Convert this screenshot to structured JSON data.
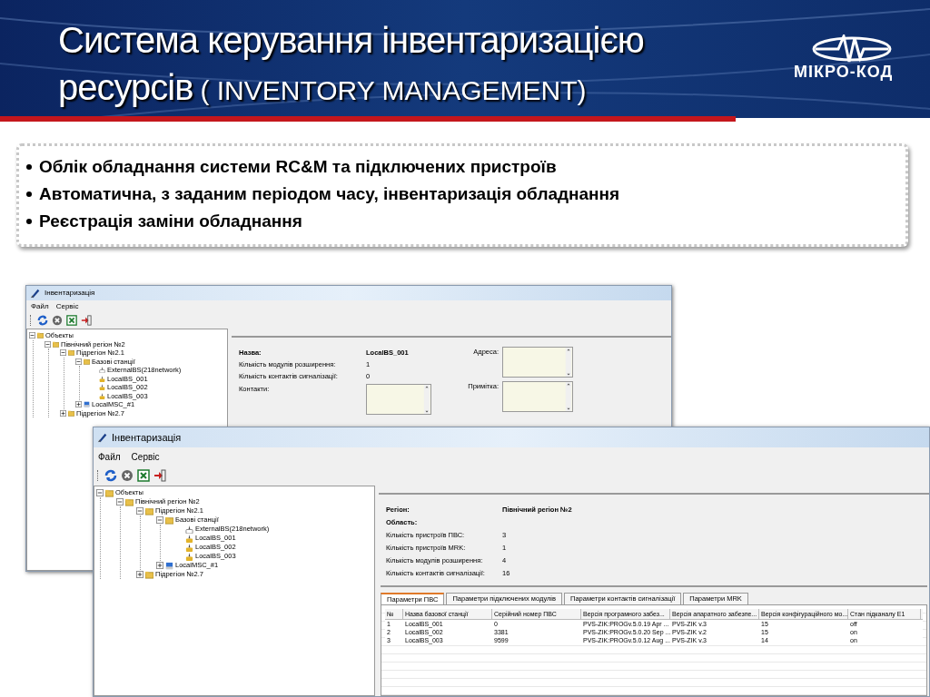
{
  "slide": {
    "title_line1": "Система керування інвентаризацією",
    "title_line2": "ресурсів",
    "title_suffix": "( INVENTORY MANAGEMENT)",
    "logo_text": "МІКРО-КОД",
    "bullets": [
      "Облік обладнання системи RC&M та підключених пристроїв",
      "Автоматична, з заданим періодом часу, інвентаризація обладнання",
      "Реєстрація заміни обладнання"
    ]
  },
  "windows": [
    {
      "title": "Інвентаризація",
      "menu": [
        "Файл",
        "Сервіс"
      ],
      "tree": [
        {
          "label": "Объекты",
          "kind": "folder",
          "expanded": true,
          "children": [
            {
              "label": "Північний регіон №2",
              "kind": "folder",
              "expanded": true,
              "children": [
                {
                  "label": "Підрегіон №2.1",
                  "kind": "folder",
                  "expanded": true,
                  "children": [
                    {
                      "label": "Базові станції",
                      "kind": "folder",
                      "expanded": true,
                      "children": [
                        {
                          "label": "ExternalBS(218network)",
                          "kind": "external"
                        },
                        {
                          "label": "LocalBS_001",
                          "kind": "station"
                        },
                        {
                          "label": "LocalBS_002",
                          "kind": "station"
                        },
                        {
                          "label": "LocalBS_003",
                          "kind": "station"
                        }
                      ]
                    },
                    {
                      "label": "LocalMSC_#1",
                      "kind": "msc",
                      "expanded": false
                    }
                  ]
                },
                {
                  "label": "Підрегіон №2.7",
                  "kind": "folder",
                  "expanded": false
                }
              ]
            }
          ]
        }
      ],
      "details": [
        {
          "label": "Назва:",
          "value": "LocalBS_001",
          "bold": true
        },
        {
          "label": "Кількість модулів розширення:",
          "value": "1",
          "bold": false
        },
        {
          "label": "Кількість контактів сигналізації:",
          "value": "0",
          "bold": false
        }
      ],
      "memos": [
        {
          "label": "Контакти:"
        },
        {
          "label": "Адреса:"
        },
        {
          "label": "Примітка:"
        }
      ]
    },
    {
      "title": "Інвентаризація",
      "menu": [
        "Файл",
        "Сервіс"
      ],
      "tree": [
        {
          "label": "Объекты",
          "kind": "folder",
          "expanded": true,
          "children": [
            {
              "label": "Північний регіон №2",
              "kind": "folder",
              "expanded": true,
              "children": [
                {
                  "label": "Підрегіон №2.1",
                  "kind": "folder",
                  "expanded": true,
                  "children": [
                    {
                      "label": "Базові станції",
                      "kind": "folder",
                      "expanded": true,
                      "children": [
                        {
                          "label": "ExternalBS(218network)",
                          "kind": "external"
                        },
                        {
                          "label": "LocalBS_001",
                          "kind": "station"
                        },
                        {
                          "label": "LocalBS_002",
                          "kind": "station"
                        },
                        {
                          "label": "LocalBS_003",
                          "kind": "station"
                        }
                      ]
                    },
                    {
                      "label": "LocalMSC_#1",
                      "kind": "msc",
                      "expanded": false
                    }
                  ]
                },
                {
                  "label": "Підрегіон №2.7",
                  "kind": "folder",
                  "expanded": false
                }
              ]
            }
          ]
        }
      ],
      "details": [
        {
          "label": "Регіон:",
          "value": "Північний регіон №2",
          "bold": true
        },
        {
          "label": "Область:",
          "bold": true
        },
        {
          "label": "Кількість пристроїв ПВС:",
          "value": "3",
          "bold": false
        },
        {
          "label": "Кількість пристроїв MRK:",
          "value": "1",
          "bold": false
        },
        {
          "label": "Кількість модулів розширення:",
          "value": "4",
          "bold": false
        },
        {
          "label": "Кількість контактів сигналізації:",
          "value": "16",
          "bold": false
        }
      ],
      "tabs": [
        {
          "label": "Параметри ПВС",
          "selected": true
        },
        {
          "label": "Параметри підключених модулів",
          "selected": false
        },
        {
          "label": "Параметри контактів сигналізації",
          "selected": false
        },
        {
          "label": "Параметри MRK",
          "selected": false
        }
      ],
      "table": {
        "columns": [
          "№",
          "Назва базової станції",
          "Серійний номер ПВС",
          "Версія програмного забез...",
          "Версія апаратного забезпе...",
          "Версія конфігураційного мо...",
          "Стан підканалу E1"
        ],
        "rows": [
          [
            "1",
            "LocalBS_001",
            "0",
            "PVS-ZIK:PROGv.5.0.19 Apr ...",
            "PVS-ZIK v.3",
            "15",
            "off"
          ],
          [
            "2",
            "LocalBS_002",
            "3381",
            "PVS-ZIK:PROGv.5.0.20 Sep ...",
            "PVS-ZIK v.2",
            "15",
            "on"
          ],
          [
            "3",
            "LocalBS_003",
            "9599",
            "PVS-ZIK:PROGv.5.0.12 Aug ...",
            "PVS-ZIK v.3",
            "14",
            "on"
          ]
        ]
      }
    }
  ]
}
